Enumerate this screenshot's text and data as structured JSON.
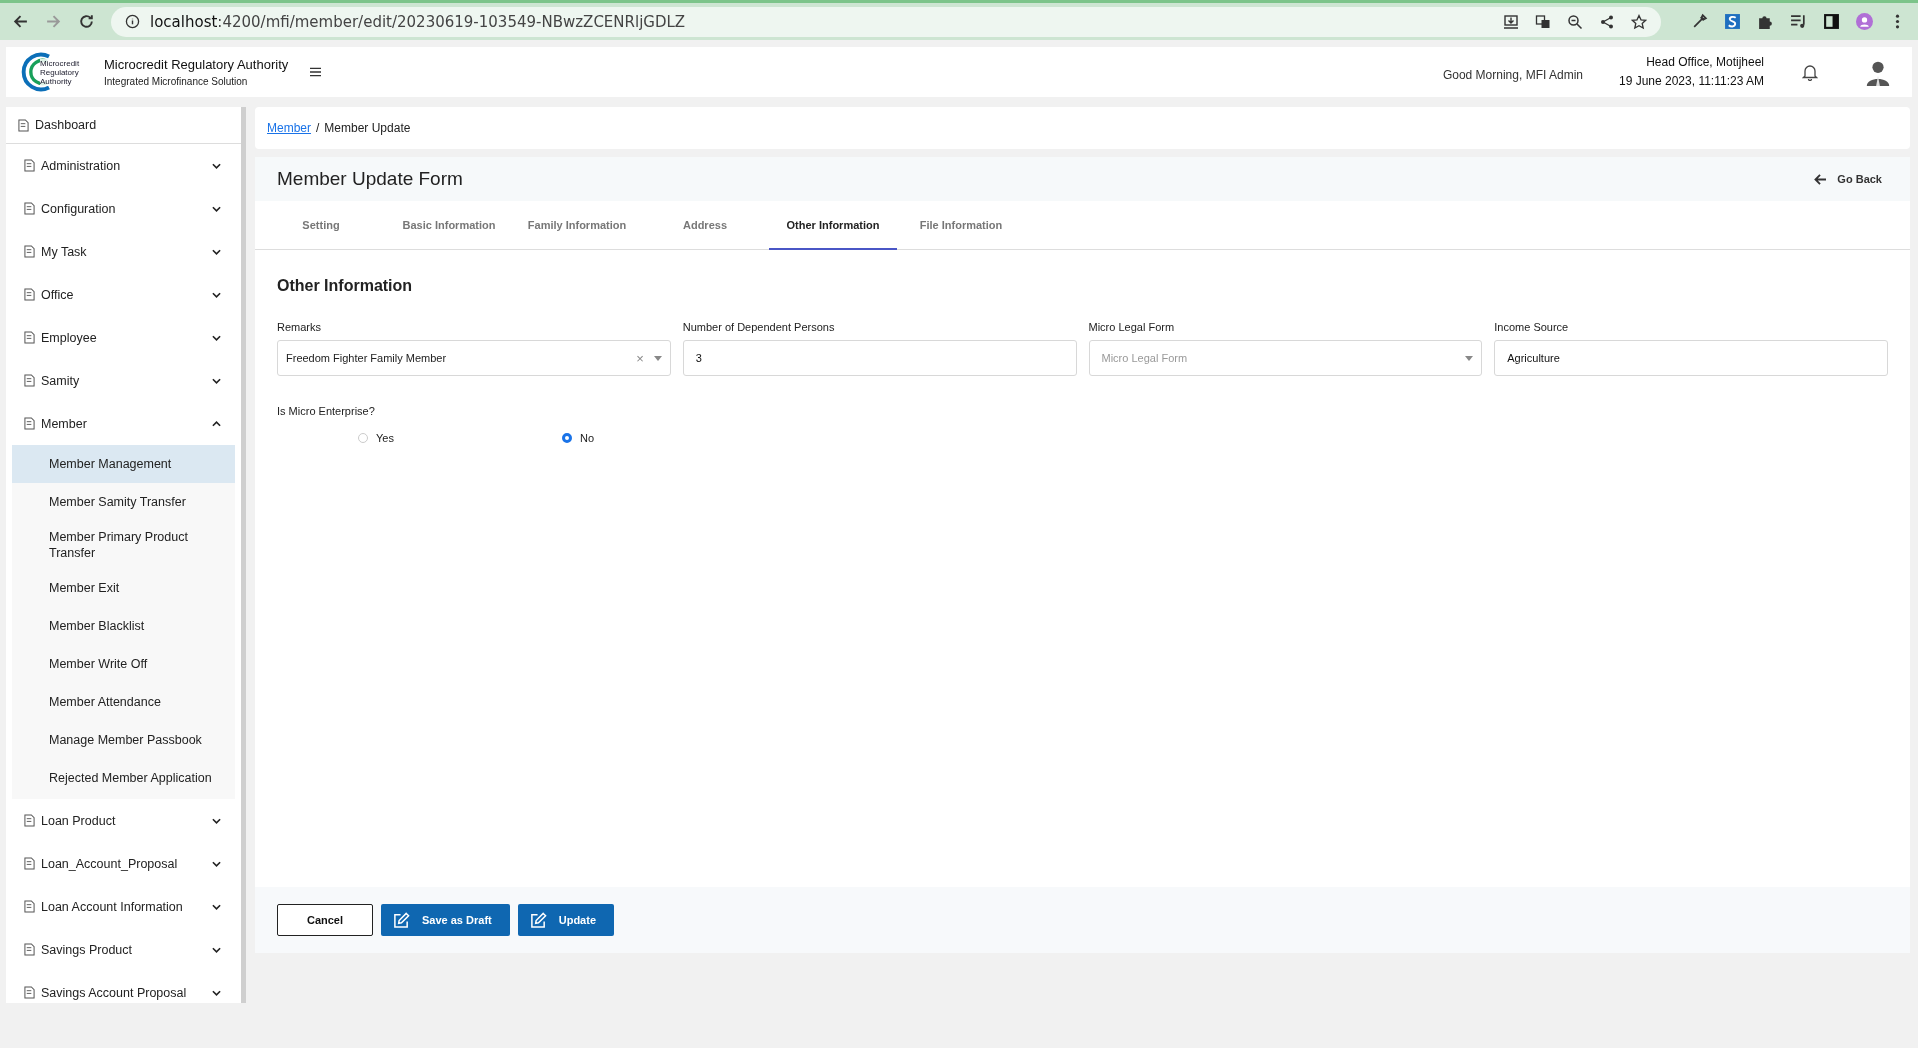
{
  "browser": {
    "url_host": "localhost",
    "url_path": ":4200/mfi/member/edit/20230619-103549-NBwzZCENRljGDLZ"
  },
  "header": {
    "logo_text": "Microcredit Regulatory Authority",
    "title": "Microcredit Regulatory Authority",
    "subtitle": "Integrated Microfinance Solution",
    "greeting": "Good Morning, MFI Admin",
    "office": "Head Office, Motijheel",
    "datetime": "19 June 2023, 11:11:23 AM"
  },
  "sidebar": {
    "items": [
      {
        "label": "Dashboard",
        "has_caret": false
      },
      {
        "label": "Administration",
        "expanded": false,
        "has_caret": true
      },
      {
        "label": "Configuration",
        "expanded": false,
        "has_caret": true
      },
      {
        "label": "My Task",
        "expanded": false,
        "has_caret": true
      },
      {
        "label": "Office",
        "expanded": false,
        "has_caret": true
      },
      {
        "label": "Employee",
        "expanded": false,
        "has_caret": true
      },
      {
        "label": "Samity",
        "expanded": false,
        "has_caret": true
      },
      {
        "label": "Member",
        "expanded": true,
        "has_caret": true,
        "children": [
          {
            "label": "Member Management",
            "selected": true
          },
          {
            "label": "Member Samity Transfer",
            "selected": false
          },
          {
            "label": "Member Primary Product Transfer",
            "selected": false
          },
          {
            "label": "Member Exit",
            "selected": false
          },
          {
            "label": "Member Blacklist",
            "selected": false
          },
          {
            "label": "Member Write Off",
            "selected": false
          },
          {
            "label": "Member Attendance",
            "selected": false
          },
          {
            "label": "Manage Member Passbook",
            "selected": false
          },
          {
            "label": "Rejected Member Application",
            "selected": false
          }
        ]
      },
      {
        "label": "Loan Product",
        "expanded": false,
        "has_caret": true
      },
      {
        "label": "Loan_Account_Proposal",
        "expanded": false,
        "has_caret": true
      },
      {
        "label": "Loan Account Information",
        "expanded": false,
        "has_caret": true
      },
      {
        "label": "Savings Product",
        "expanded": false,
        "has_caret": true
      },
      {
        "label": "Savings Account Proposal",
        "expanded": false,
        "has_caret": true
      }
    ]
  },
  "breadcrumb": [
    {
      "label": "Member",
      "link": true
    },
    {
      "label": "Member Update",
      "link": false
    }
  ],
  "breadcrumb_separator": "/",
  "form": {
    "title": "Member Update Form",
    "go_back": "Go Back",
    "tabs": [
      {
        "label": "Setting",
        "selected": false
      },
      {
        "label": "Basic Information",
        "selected": false
      },
      {
        "label": "Family Information",
        "selected": false
      },
      {
        "label": "Address",
        "selected": false
      },
      {
        "label": "Other Information",
        "selected": true
      },
      {
        "label": "File Information",
        "selected": false
      }
    ],
    "section_title": "Other Information",
    "fields": [
      {
        "label": "Remarks",
        "kind": "select",
        "value": "Freedom Fighter Family Member",
        "clearable": true
      },
      {
        "label": "Number of Dependent Persons",
        "kind": "input",
        "value": "3"
      },
      {
        "label": "Micro Legal Form",
        "kind": "select",
        "placeholder": "Micro Legal Form",
        "clearable": false
      },
      {
        "label": "Income Source",
        "kind": "input",
        "value": "Agriculture"
      }
    ],
    "question": "Is Micro Enterprise?",
    "clear_glyph": "×",
    "options": [
      {
        "label": "Yes",
        "selected": false
      },
      {
        "label": "No",
        "selected": true
      }
    ],
    "buttons": [
      {
        "label": "Cancel",
        "kind": "outline"
      },
      {
        "label": "Save as Draft",
        "kind": "primary"
      },
      {
        "label": "Update",
        "kind": "primary"
      }
    ]
  }
}
